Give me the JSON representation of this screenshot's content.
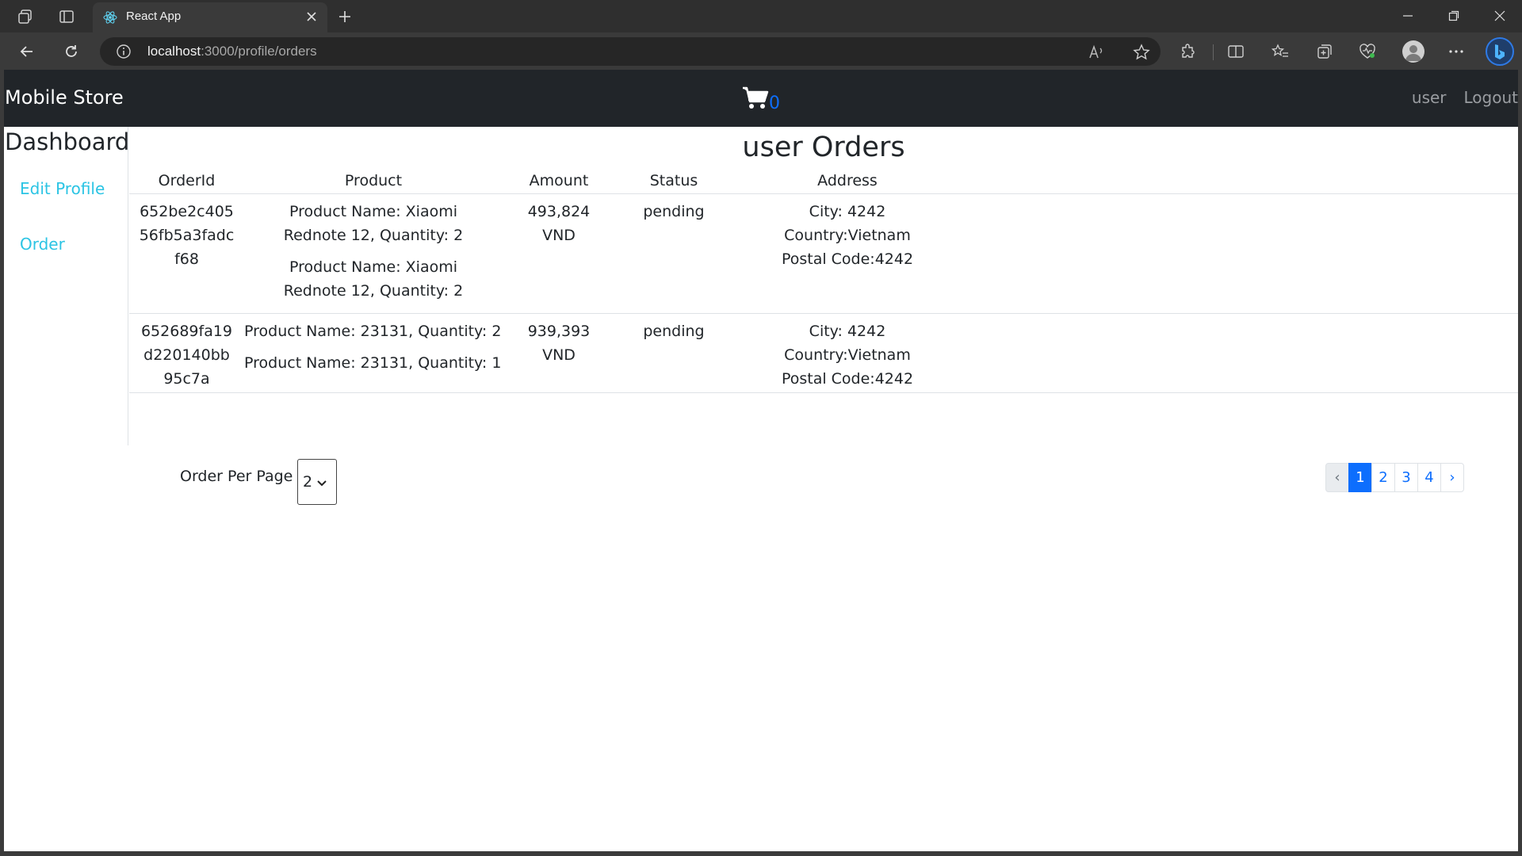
{
  "browser": {
    "tab_title": "React App",
    "url_host": "localhost",
    "url_path": ":3000/profile/orders"
  },
  "navbar": {
    "brand": "Mobile Store",
    "cart_count": "0",
    "links": [
      "user",
      "Logout"
    ]
  },
  "sidebar": {
    "title": "Dashboard",
    "items": [
      "Edit Profile",
      "Order"
    ]
  },
  "main": {
    "title": "user Orders",
    "columns": [
      "OrderId",
      "Product",
      "Amount",
      "Status",
      "Address"
    ],
    "orders": [
      {
        "id_lines": [
          "652be2c405",
          "56fb5a3fadc",
          "f68"
        ],
        "products": [
          "Product Name: Xiaomi Rednote 12, Quantity: 2",
          "Product Name: Xiaomi Rednote 12, Quantity: 2"
        ],
        "amount": "493,824",
        "currency": "VND",
        "status": "pending",
        "address": [
          "City: 4242",
          "Country:Vietnam",
          "Postal Code:4242"
        ]
      },
      {
        "id_lines": [
          "652689fa19",
          "d220140bb",
          "95c7a"
        ],
        "products": [
          "Product Name: 23131, Quantity: 2",
          "Product Name: 23131, Quantity: 1"
        ],
        "amount": "939,393",
        "currency": "VND",
        "status": "pending",
        "address": [
          "City: 4242",
          "Country:Vietnam",
          "Postal Code:4242"
        ]
      }
    ],
    "per_page_label": "Order Per Page",
    "per_page_value": "2",
    "pagination": {
      "prev": "‹",
      "pages": [
        "1",
        "2",
        "3",
        "4"
      ],
      "active": "1",
      "next": "›"
    }
  }
}
